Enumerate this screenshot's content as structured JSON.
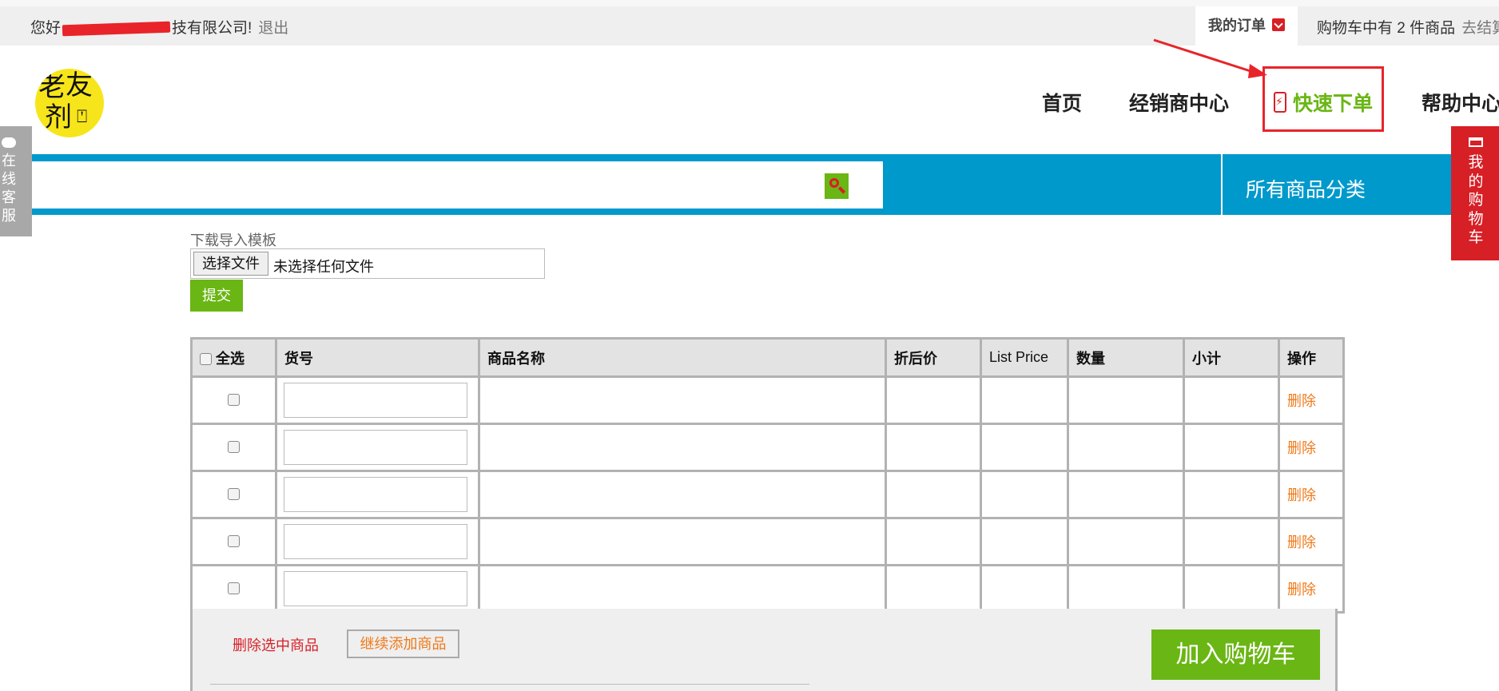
{
  "topbar": {
    "greeting_prefix": "您好",
    "greeting_suffix": "技有限公司!",
    "logout": "退出",
    "my_orders": "我的订单",
    "cart_summary": "购物车中有 2 件商品",
    "checkout": "去结算"
  },
  "logo": {
    "chars": [
      "老",
      "友",
      "剂",
      "⍞"
    ]
  },
  "nav": {
    "home": "首页",
    "dealer_center": "经销商中心",
    "quick_order": "快速下单",
    "help_center": "帮助中心"
  },
  "search": {
    "placeholder": "",
    "category_label": "所有商品分类"
  },
  "side": {
    "online_service": "在线客服",
    "my_cart": "我的购物车"
  },
  "upload": {
    "download_template": "下载导入模板",
    "choose_file": "选择文件",
    "file_status": "未选择任何文件",
    "submit": "提交"
  },
  "table": {
    "headers": {
      "select_all": "全选",
      "sku": "货号",
      "name": "商品名称",
      "discount_price": "折后价",
      "list_price": "List Price",
      "quantity": "数量",
      "subtotal": "小计",
      "action": "操作"
    },
    "rows": [
      {
        "delete": "删除"
      },
      {
        "delete": "删除"
      },
      {
        "delete": "删除"
      },
      {
        "delete": "删除"
      },
      {
        "delete": "删除"
      }
    ]
  },
  "footer": {
    "delete_selected": "删除选中商品",
    "continue_add": "继续添加商品",
    "add_to_cart": "加入购物车"
  },
  "colors": {
    "brand_blue": "#0099cc",
    "brand_green": "#6ab614",
    "brand_red": "#d71f26",
    "link_orange": "#ef7a1a"
  }
}
